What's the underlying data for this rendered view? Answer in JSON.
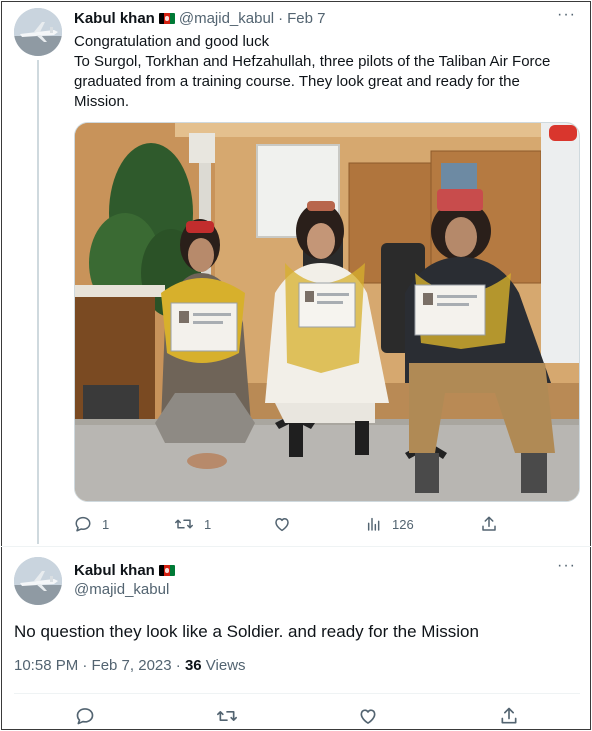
{
  "tweet1": {
    "name": "Kabul khan",
    "handle": "@majid_kabul",
    "separator": "·",
    "date": "Feb 7",
    "more": "···",
    "lines": [
      "Congratulation and good luck",
      "To Surgol, Torkhan and Hefzahullah, three pilots of the Taliban Air Force graduated from a training course. They look great and ready for the Mission."
    ],
    "photo_icon": "photo-of-three-men-with-certificates",
    "actions": {
      "reply_count": "1",
      "retweet_count": "1",
      "like_count": "",
      "views_count": "126"
    }
  },
  "tweet2": {
    "name": "Kabul khan",
    "handle": "@majid_kabul",
    "more": "···",
    "text": "No question they look like a Soldier.  and ready for the Mission",
    "time": "10:58 PM · Feb 7, 2023 · ",
    "views_count": "36",
    "views_label": " Views"
  },
  "icons": [
    "reply-icon",
    "retweet-icon",
    "like-icon",
    "views-icon",
    "share-icon",
    "flag-afghanistan-icon",
    "more-icon"
  ],
  "colors": {
    "text": "#0f1419",
    "muted": "#536471",
    "border": "#cfd9de"
  }
}
